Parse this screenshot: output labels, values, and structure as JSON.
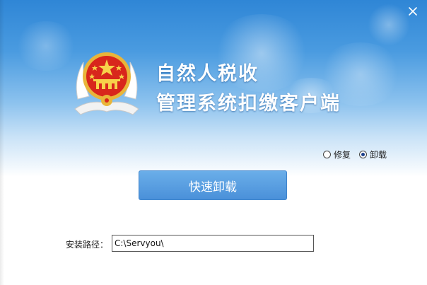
{
  "window": {
    "title_line1": "自然人税收",
    "title_line2": "管理系统扣缴客户端",
    "close_icon": "close-icon",
    "emblem_icon": "national-emblem-icon"
  },
  "options": {
    "repair_label": "修复",
    "uninstall_label": "卸载",
    "selected": "uninstall"
  },
  "action": {
    "button_label": "快速卸载"
  },
  "install_path": {
    "label": "安装路径：",
    "value": "C:\\Servyou\\"
  },
  "colors": {
    "banner_top": "#2f86d6",
    "button": "#4a90d9",
    "emblem_red": "#d8261c",
    "emblem_gold": "#e9b53a"
  }
}
